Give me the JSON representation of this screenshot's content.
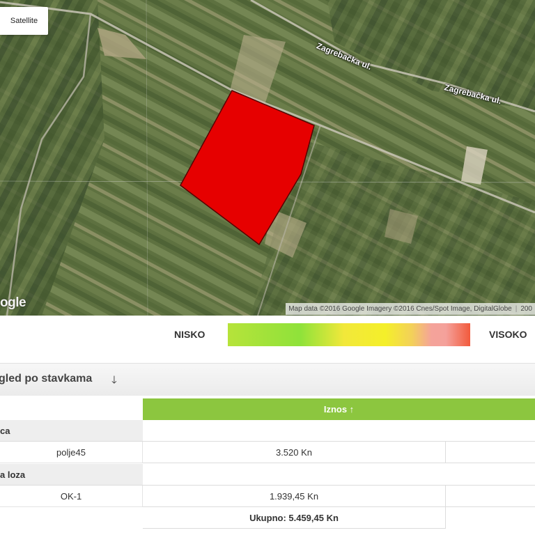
{
  "map": {
    "type_control": "Satellite",
    "logo_text": "ogle",
    "attribution": "Map data ©2016 Google Imagery ©2016 Cnes/Spot Image, DigitalGlobe",
    "attribution_extra": "200",
    "road_labels": [
      "Zagrebačka ul.",
      "Zagrebačka ul."
    ],
    "parcel_color": "#e60000"
  },
  "legend": {
    "low_label": "NISKO",
    "high_label": "VISOKO"
  },
  "section": {
    "title": "gled po stavkama",
    "sort_arrow": "🡓"
  },
  "table": {
    "header": {
      "amount": "Iznos ↑"
    },
    "groups": [
      {
        "name": "ca",
        "rows": [
          {
            "label": "polje45",
            "amount": "3.520 Kn"
          }
        ]
      },
      {
        "name": "a loza",
        "rows": [
          {
            "label": "OK-1",
            "amount": "1.939,45 Kn"
          }
        ]
      }
    ],
    "total": "Ukupno: 5.459,45 Kn"
  }
}
